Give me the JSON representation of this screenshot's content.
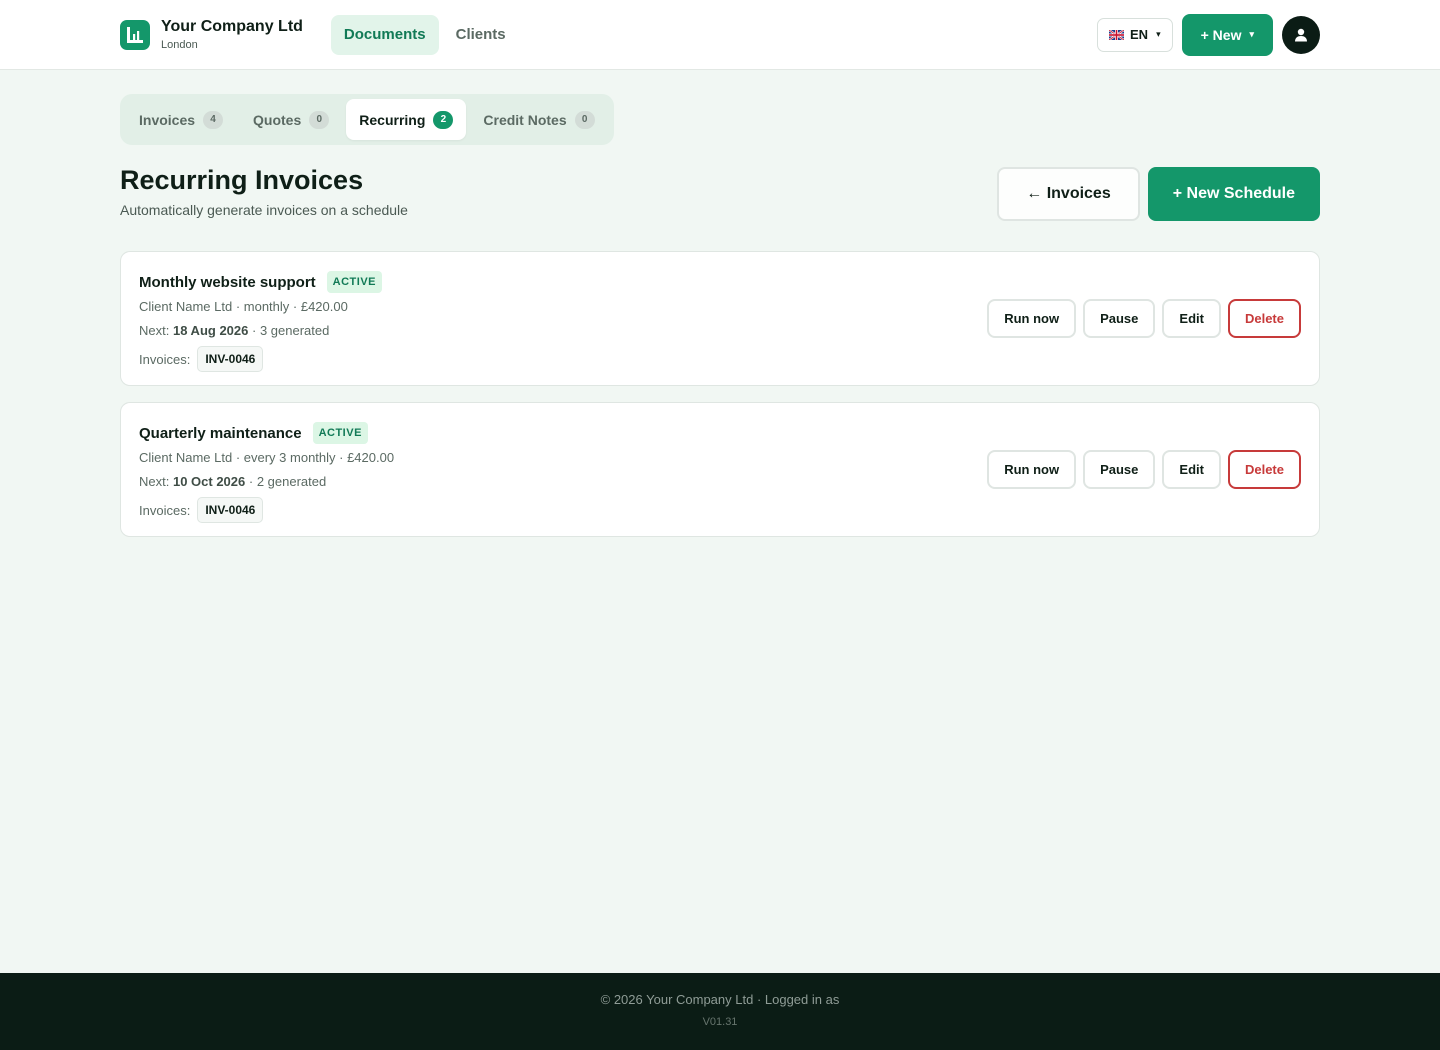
{
  "brand": {
    "name": "Your Company Ltd",
    "city": "London",
    "logo_icon": "chart-icon"
  },
  "nav": [
    {
      "label": "Documents",
      "active": true
    },
    {
      "label": "Clients",
      "active": false
    }
  ],
  "header": {
    "language": "EN",
    "new_label": "+ New",
    "caret": "▾"
  },
  "tabs": [
    {
      "label": "Invoices",
      "count": "4",
      "active": false
    },
    {
      "label": "Quotes",
      "count": "0",
      "active": false
    },
    {
      "label": "Recurring",
      "count": "2",
      "active": true
    },
    {
      "label": "Credit Notes",
      "count": "0",
      "active": false
    }
  ],
  "page": {
    "title": "Recurring Invoices",
    "subtitle": "Automatically generate invoices on a schedule",
    "back_label": "← Invoices",
    "new_schedule_label": "+ New Schedule"
  },
  "schedules": [
    {
      "title": "Monthly website support",
      "status": "ACTIVE",
      "meta": "Client Name Ltd · monthly · £420.00",
      "next_prefix": "Next:",
      "next_date": "18 Aug 2026",
      "next_suffix": "· 3 generated",
      "invoices_label": "Invoices:",
      "invoices": [
        "INV-0046"
      ]
    },
    {
      "title": "Quarterly maintenance",
      "status": "ACTIVE",
      "meta": "Client Name Ltd · every 3 monthly · £420.00",
      "next_prefix": "Next:",
      "next_date": "10 Oct 2026",
      "next_suffix": "· 2 generated",
      "invoices_label": "Invoices:",
      "invoices": [
        "INV-0046"
      ]
    }
  ],
  "card_actions": {
    "run_now": "Run now",
    "pause": "Pause",
    "edit": "Edit",
    "delete": "Delete"
  },
  "footer": {
    "text": "© 2026 Your Company Ltd · Logged in as",
    "version": "V01.31"
  },
  "colors": {
    "accent": "#14976a",
    "danger": "#c73a3a",
    "footer_bg": "#0b1c15"
  }
}
